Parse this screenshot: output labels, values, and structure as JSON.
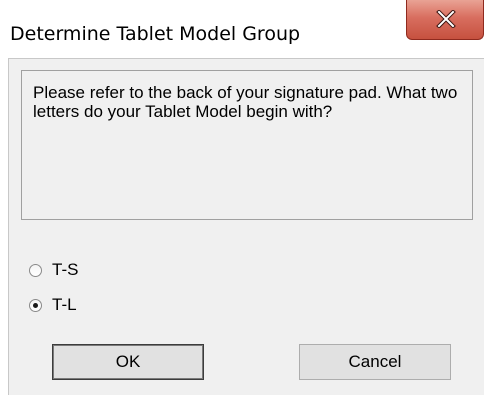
{
  "window": {
    "title": "Determine Tablet Model Group"
  },
  "message": {
    "text": "Please refer to the back of your signature pad. What two letters do your Tablet Model begin with?"
  },
  "options": [
    {
      "label": "T-S",
      "selected": false
    },
    {
      "label": "T-L",
      "selected": true
    }
  ],
  "buttons": {
    "ok_label": "OK",
    "cancel_label": "Cancel"
  },
  "colors": {
    "close_button": "#d86e5f",
    "dialog_background": "#f0f0f0"
  },
  "icons": {
    "close": "close-icon"
  }
}
